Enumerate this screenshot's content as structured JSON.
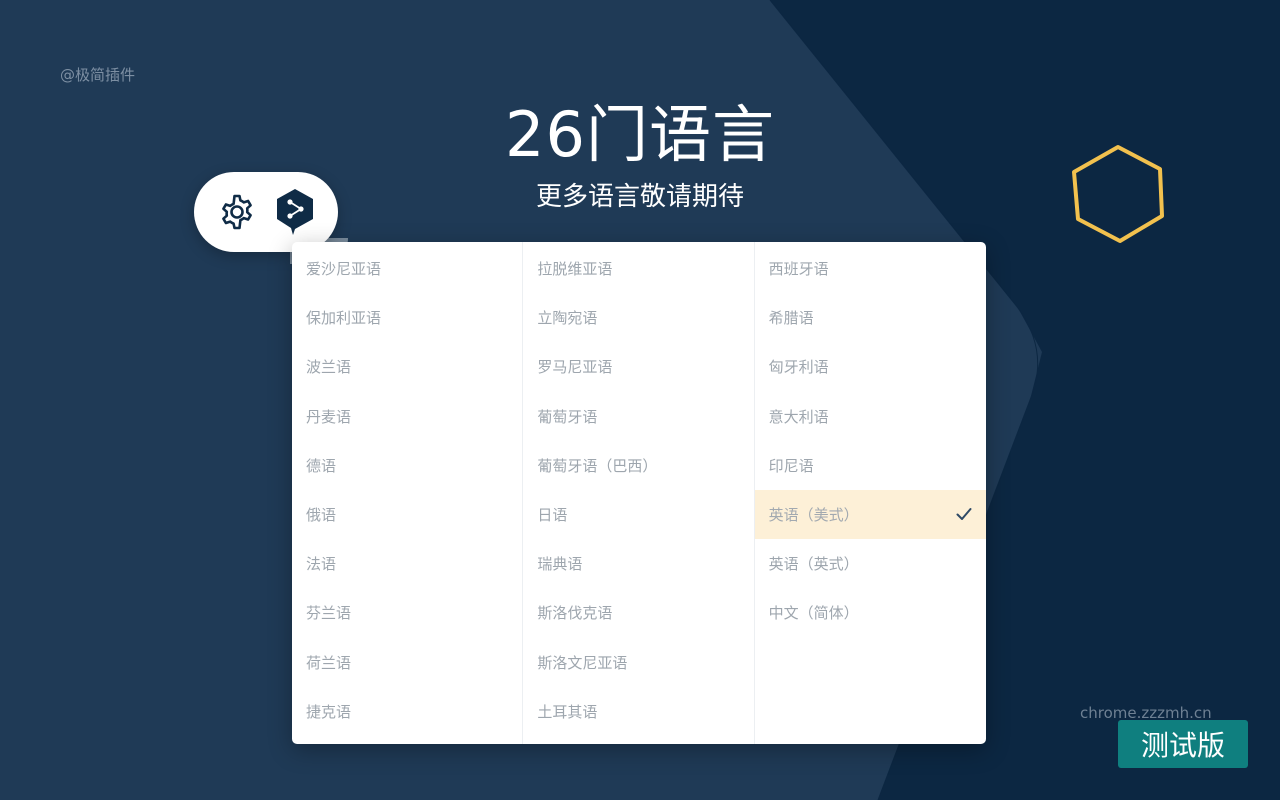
{
  "watermark_top": "@极简插件",
  "headline": "26门语言",
  "subline": "更多语言敬请期待",
  "toolbar": {
    "settings_icon": "gear-icon",
    "logo_icon": "deepl-logo-icon"
  },
  "languages": {
    "col1": [
      "爱沙尼亚语",
      "保加利亚语",
      "波兰语",
      "丹麦语",
      "德语",
      "俄语",
      "法语",
      "芬兰语",
      "荷兰语",
      "捷克语"
    ],
    "col2": [
      "拉脱维亚语",
      "立陶宛语",
      "罗马尼亚语",
      "葡萄牙语",
      "葡萄牙语（巴西）",
      "日语",
      "瑞典语",
      "斯洛伐克语",
      "斯洛文尼亚语",
      "土耳其语"
    ],
    "col3": [
      "西班牙语",
      "希腊语",
      "匈牙利语",
      "意大利语",
      "印尼语",
      "英语（美式）",
      "英语（英式）",
      "中文（简体）"
    ],
    "selected": "英语（美式）"
  },
  "site_mark": "chrome.zzzmh.cn",
  "beta_badge": "测试版",
  "colors": {
    "background": "#1f3a56",
    "dark_shape": "#0c2742",
    "hexagon": "#f2c14e",
    "selected_row": "#fdf0d7",
    "badge": "#0f7f7f",
    "logo": "#0f2b46"
  }
}
